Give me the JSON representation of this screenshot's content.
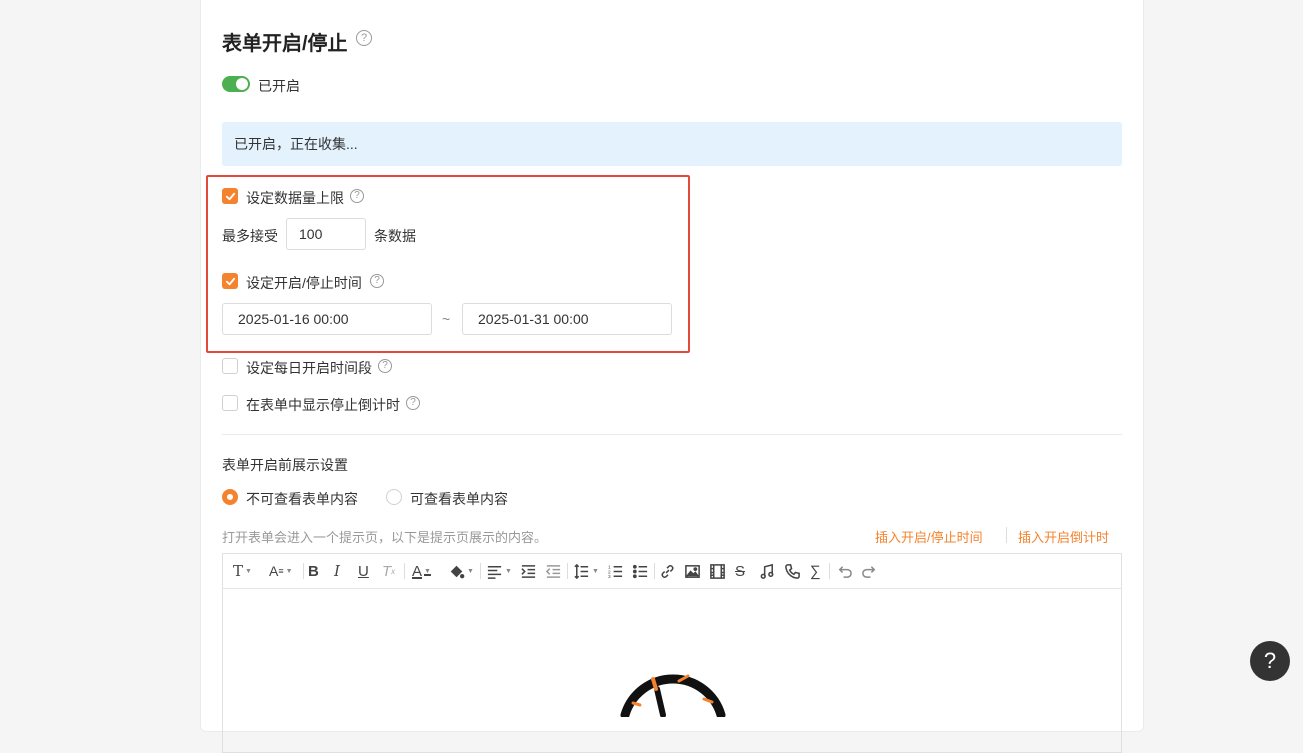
{
  "title": "表单开启/停止",
  "help_symbol": "?",
  "toggle": {
    "label": "已开启",
    "on": true,
    "color": "#4caf50"
  },
  "banner": {
    "text": "已开启，正在收集..."
  },
  "options": {
    "data_limit": {
      "label": "设定数据量上限",
      "checked": true
    },
    "max_accept": {
      "prefix": "最多接受",
      "value": "100",
      "suffix": "条数据"
    },
    "time_range": {
      "label": "设定开启/停止时间",
      "checked": true,
      "start": "2025-01-16 00:00",
      "separator": "~",
      "end": "2025-01-31 00:00"
    },
    "daily_period": {
      "label": "设定每日开启时间段",
      "checked": false
    },
    "countdown": {
      "label": "在表单中显示停止倒计时",
      "checked": false
    }
  },
  "pre_open": {
    "heading": "表单开启前展示设置",
    "radios": [
      {
        "label": "不可查看表单内容",
        "selected": true
      },
      {
        "label": "可查看表单内容",
        "selected": false
      }
    ],
    "hint": "打开表单会进入一个提示页，以下是提示页展示的内容。",
    "links": {
      "insert_time": "插入开启/停止时间",
      "insert_countdown": "插入开启倒计时"
    }
  },
  "toolbar_icons": [
    "font-size-icon",
    "font-style-icon",
    "bold-icon",
    "italic-icon",
    "underline-icon",
    "clear-format-icon",
    "font-color-icon",
    "background-color-icon",
    "align-icon",
    "indent-icon",
    "outdent-icon",
    "line-height-icon",
    "ordered-list-icon",
    "unordered-list-icon",
    "link-icon",
    "image-icon",
    "video-icon",
    "strikethrough-icon",
    "audio-icon",
    "phone-icon",
    "formula-icon",
    "undo-icon",
    "redo-icon"
  ],
  "colors": {
    "accent": "#f5832e",
    "highlight_border": "#e24b3c",
    "banner_bg": "#e3f2fd"
  },
  "help_fab": "?"
}
